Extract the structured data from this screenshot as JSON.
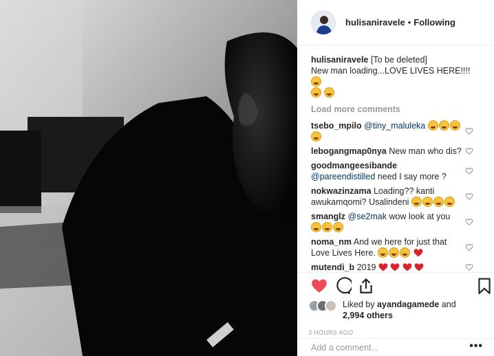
{
  "post": {
    "username": "hulisaniravele",
    "separator": "•",
    "follow_status": "Following",
    "caption_user": "hulisaniravele",
    "caption_line1": "[To be deleted]",
    "caption_line2": "New man loading...LOVE LIVES HERE!!!!"
  },
  "load_more": "Load more comments",
  "comments": [
    {
      "user": "tsebo_mpilo",
      "mention": "@tiny_maluleka",
      "text": "",
      "emoji_count": 4,
      "hearts": 0
    },
    {
      "user": "lebogangmap0nya",
      "mention": "",
      "text": "New man who dis?",
      "emoji_count": 0,
      "hearts": 0
    },
    {
      "user": "goodmangeesibande",
      "mention": "@pareendistilled",
      "text": "need I say more ?",
      "emoji_count": 0,
      "hearts": 0
    },
    {
      "user": "nokwazinzama",
      "mention": "",
      "text": "Loading?? kanti awukamqomi? Usalindeni",
      "emoji_count": 4,
      "hearts": 0
    },
    {
      "user": "smanglz",
      "mention": "@se2mak",
      "text": "wow look at you",
      "emoji_count": 3,
      "hearts": 0
    },
    {
      "user": "noma_nm",
      "mention": "",
      "text": "And we here for just that Love Lives Here.",
      "emoji_count": 3,
      "hearts": 1
    },
    {
      "user": "mutendi_b",
      "mention": "",
      "text": "2019",
      "emoji_count": 0,
      "hearts": 4
    }
  ],
  "likes": {
    "prefix": "Liked by",
    "user": "ayandagamede",
    "suffix": "and",
    "others": "2,994 others"
  },
  "timestamp": "3 HOURS AGO",
  "add_comment_placeholder": "Add a comment...",
  "more_options": "•••",
  "icons": {
    "like": "heart-filled-icon",
    "comment": "comment-bubble-icon",
    "share": "share-icon",
    "save": "bookmark-icon",
    "comment_like": "heart-outline-icon"
  },
  "colors": {
    "like_red": "#ed4956",
    "mention_blue": "#003569",
    "muted": "#999999"
  }
}
